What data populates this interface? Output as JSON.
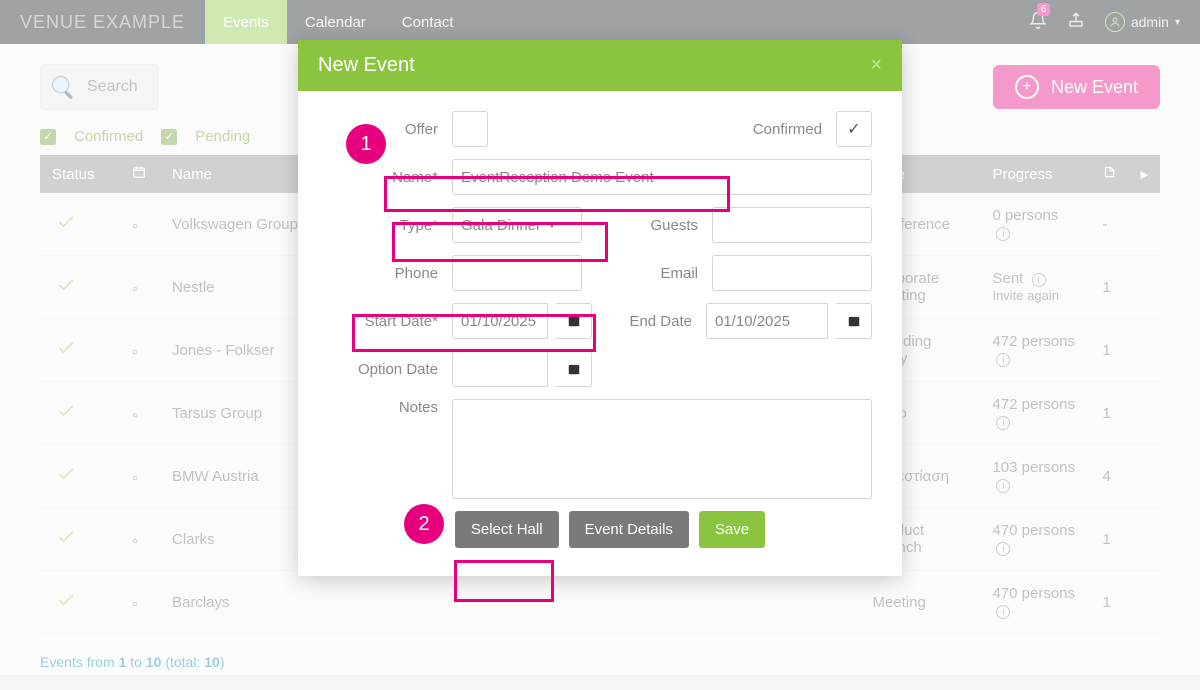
{
  "brand": "VENUE EXAMPLE",
  "nav": {
    "events": "Events",
    "calendar": "Calendar",
    "contact": "Contact"
  },
  "notif_count": "6",
  "user": "admin",
  "search_label": "Search",
  "new_event_label": "New Event",
  "filters": {
    "confirmed": "Confirmed",
    "pending": "Pending"
  },
  "cols": {
    "status": "Status",
    "name": "Name",
    "type": "Type",
    "progress": "Progress"
  },
  "rows": [
    {
      "name": "Volkswagen Group",
      "type": "Conference",
      "progress": "0 persons",
      "count": "-"
    },
    {
      "name": "Nestle",
      "type": "Corporate Meeting",
      "progress": "Sent",
      "extra": "Invite again",
      "count": "1"
    },
    {
      "name": "Jones - Folkser",
      "type": "Wedding Party",
      "progress": "472 persons",
      "count": "1"
    },
    {
      "name": "Tarsus Group",
      "type": "Expo",
      "progress": "472 persons",
      "count": "1"
    },
    {
      "name": "BMW Austria",
      "type": "Συνεστίαση",
      "progress": "103 persons",
      "count": "4"
    },
    {
      "name": "Clarks",
      "type": "Product Launch",
      "progress": "470 persons",
      "count": "1"
    },
    {
      "name": "Barclays",
      "type": "Meeting",
      "progress": "470 persons",
      "count": "1"
    }
  ],
  "pager": {
    "a": "Events from ",
    "b": "1",
    "c": " to ",
    "d": "10",
    "e": " (total: ",
    "f": "10",
    "g": ")"
  },
  "modal": {
    "title": "New Event",
    "offer": "Offer",
    "confirmed": "Confirmed",
    "name": "Name*",
    "name_val": "EventReception Demo Event",
    "type": "Type*",
    "type_val": "Gala Dinner",
    "guests": "Guests",
    "phone": "Phone",
    "email": "Email",
    "start": "Start Date*",
    "start_val": "01/10/2025",
    "end": "End Date",
    "end_val": "01/10/2025",
    "option": "Option Date",
    "notes": "Notes",
    "select_hall": "Select Hall",
    "event_details": "Event Details",
    "save": "Save"
  },
  "annot": {
    "one": "1",
    "two": "2"
  }
}
